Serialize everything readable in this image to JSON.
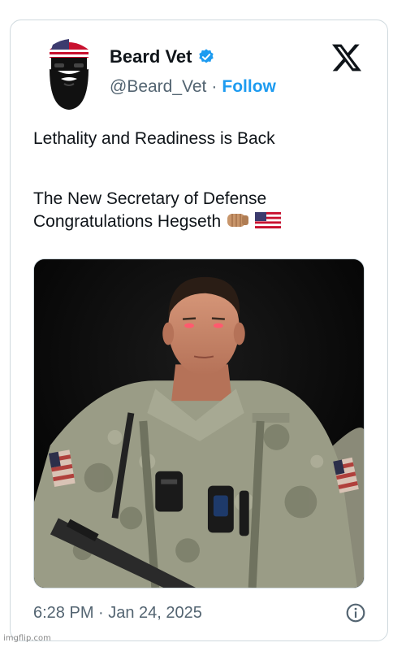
{
  "tweet": {
    "author": {
      "display_name": "Beard Vet",
      "handle": "@Beard_Vet",
      "separator": "·",
      "follow_label": "Follow",
      "verified": true,
      "avatar_icon": "bearded-man-flag-bandana-icon"
    },
    "platform_icon": "x-logo-icon",
    "text_lines": [
      "Lethality and Readiness is Back",
      "The New Secretary of Defense",
      "Congratulations Hegseth"
    ],
    "emojis": [
      "fist-bump-emoji",
      "us-flag-emoji"
    ],
    "media": {
      "type": "photo",
      "icon": "soldier-photo-image"
    },
    "timestamp": "6:28 PM · Jan 24, 2025",
    "info_icon": "info-icon"
  },
  "watermark": "imgflip.com",
  "colors": {
    "accent": "#1d9bf0",
    "text": "#0f1419",
    "secondary_text": "#536471",
    "border": "#cfd9de"
  }
}
